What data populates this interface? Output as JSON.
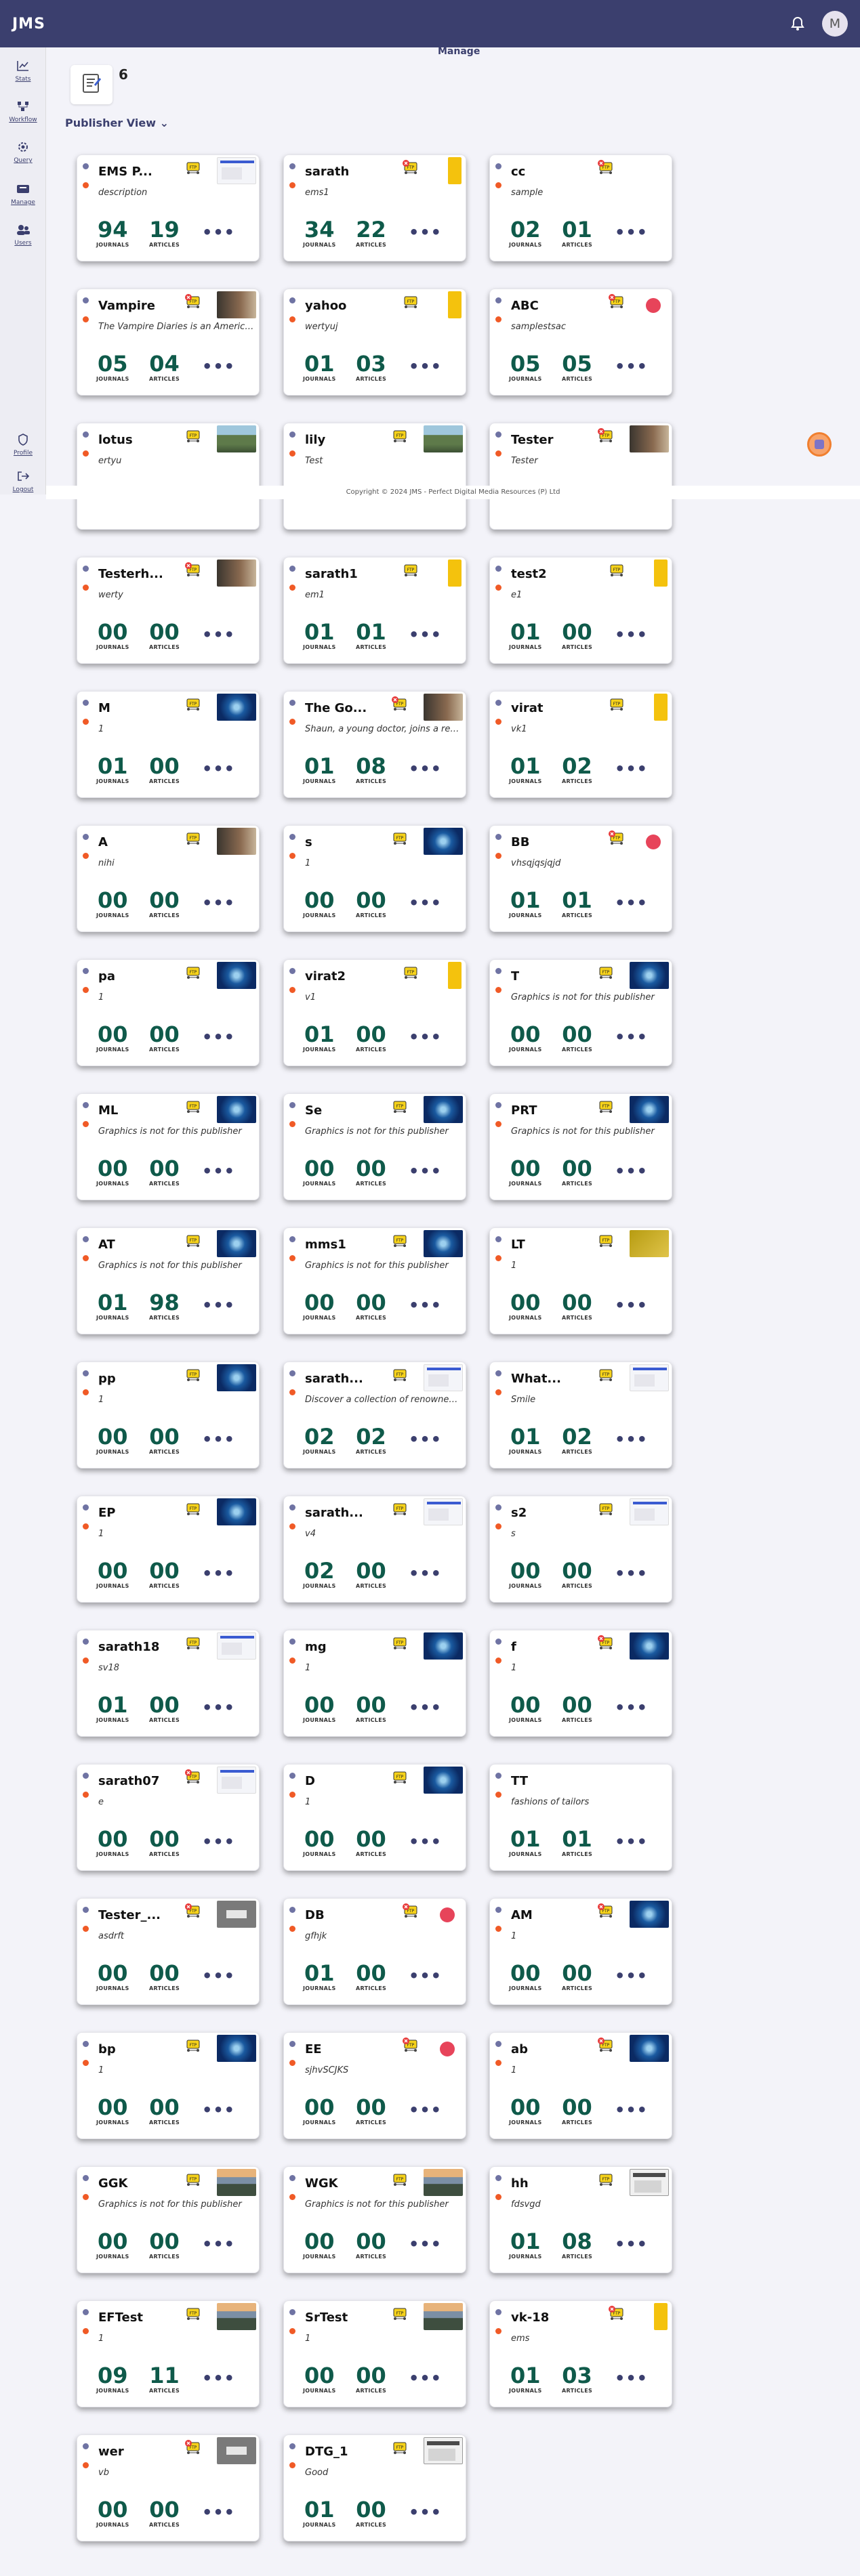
{
  "app": {
    "title": "JMS",
    "avatar_initial": "M"
  },
  "sidebar": {
    "items": [
      {
        "label": "Stats",
        "icon": "chart-line-icon"
      },
      {
        "label": "Workflow",
        "icon": "workflow-icon"
      },
      {
        "label": "Query",
        "icon": "gear-icon"
      },
      {
        "label": "Manage",
        "icon": "manage-icon"
      },
      {
        "label": "Users",
        "icon": "users-icon"
      },
      {
        "label": "Profile",
        "icon": "shield-icon"
      },
      {
        "label": "Logout",
        "icon": "logout-icon"
      }
    ]
  },
  "header": {
    "manage_link": "Manage",
    "publisher_count": "6",
    "publisher_view": "Publisher View"
  },
  "labels": {
    "journals": "JOURNALS",
    "articles": "ARTICLES",
    "more": "•••"
  },
  "footer": {
    "text": "Copyright © 2024 JMS - Perfect Digital Media Resources (P) Ltd"
  },
  "colors": {
    "topbar": "#3b3f6e",
    "accent_number": "#0f5a4a",
    "status_dot_top": "#6f73a3",
    "status_dot_bottom": "#f05a26"
  },
  "publishers": [
    {
      "name": "EMS P...",
      "desc": "description",
      "journals": "94",
      "articles": "19",
      "badge": "ftp",
      "thumb": "screenshot"
    },
    {
      "name": "sarath",
      "desc": "ems1",
      "journals": "34",
      "articles": "22",
      "badge": "ftp-x",
      "thumb": "yellow"
    },
    {
      "name": "cc",
      "desc": "sample",
      "journals": "02",
      "articles": "01",
      "badge": "ftp-x",
      "thumb": "batwing"
    },
    {
      "name": "Vampire",
      "desc": "The Vampire Diaries is an American...",
      "journals": "05",
      "articles": "04",
      "badge": "ftp-x",
      "thumb": "bookcover"
    },
    {
      "name": "yahoo",
      "desc": "wertyuj",
      "journals": "01",
      "articles": "03",
      "badge": "ftp",
      "thumb": "yellow"
    },
    {
      "name": "ABC",
      "desc": "samplestsac",
      "journals": "05",
      "articles": "05",
      "badge": "ftp-x",
      "thumb": "redcircle"
    },
    {
      "name": "lotus",
      "desc": "ertyu",
      "journals": "",
      "articles": "",
      "badge": "ftp",
      "thumb": "landscape"
    },
    {
      "name": "lily",
      "desc": "Test",
      "journals": "",
      "articles": "",
      "badge": "ftp",
      "thumb": "landscape"
    },
    {
      "name": "Tester",
      "desc": "Tester",
      "journals": "",
      "articles": "",
      "badge": "ftp-x",
      "thumb": "bookcover"
    },
    {
      "name": "Testerh...",
      "desc": "werty",
      "journals": "00",
      "articles": "00",
      "badge": "ftp-x",
      "thumb": "bookcover"
    },
    {
      "name": "sarath1",
      "desc": "em1",
      "journals": "01",
      "articles": "01",
      "badge": "ftp",
      "thumb": "yellow"
    },
    {
      "name": "test2",
      "desc": "e1",
      "journals": "01",
      "articles": "00",
      "badge": "ftp",
      "thumb": "yellow"
    },
    {
      "name": "M",
      "desc": "1",
      "journals": "01",
      "articles": "00",
      "badge": "ftp",
      "thumb": "nightsky"
    },
    {
      "name": "The Go...",
      "desc": "Shaun, a young doctor, joins a reno...",
      "journals": "01",
      "articles": "08",
      "badge": "ftp-x",
      "thumb": "bookcover"
    },
    {
      "name": "virat",
      "desc": "vk1",
      "journals": "01",
      "articles": "02",
      "badge": "ftp",
      "thumb": "yellow"
    },
    {
      "name": "A",
      "desc": "nihi",
      "journals": "00",
      "articles": "00",
      "badge": "ftp",
      "thumb": "bookcover"
    },
    {
      "name": "s",
      "desc": "1",
      "journals": "00",
      "articles": "00",
      "badge": "ftp",
      "thumb": "nightsky"
    },
    {
      "name": "BB",
      "desc": "vhsqjqsjqjd",
      "journals": "01",
      "articles": "01",
      "badge": "ftp-x",
      "thumb": "redcircle"
    },
    {
      "name": "pa",
      "desc": "1",
      "journals": "00",
      "articles": "00",
      "badge": "ftp",
      "thumb": "nightsky"
    },
    {
      "name": "virat2",
      "desc": "v1",
      "journals": "01",
      "articles": "00",
      "badge": "ftp",
      "thumb": "yellow"
    },
    {
      "name": "T",
      "desc": "Graphics is not for this publisher",
      "journals": "00",
      "articles": "00",
      "badge": "ftp",
      "thumb": "nightsky"
    },
    {
      "name": "ML",
      "desc": "Graphics is not for this publisher",
      "journals": "00",
      "articles": "00",
      "badge": "ftp",
      "thumb": "nightsky"
    },
    {
      "name": "Se",
      "desc": "Graphics is not for this publisher",
      "journals": "00",
      "articles": "00",
      "badge": "ftp",
      "thumb": "nightsky"
    },
    {
      "name": "PRT",
      "desc": "Graphics is not for this publisher",
      "journals": "00",
      "articles": "00",
      "badge": "ftp",
      "thumb": "nightsky"
    },
    {
      "name": "AT",
      "desc": "Graphics is not for this publisher",
      "journals": "01",
      "articles": "98",
      "badge": "ftp",
      "thumb": "nightsky"
    },
    {
      "name": "mms1",
      "desc": "Graphics is not for this publisher",
      "journals": "00",
      "articles": "00",
      "badge": "ftp",
      "thumb": "nightsky"
    },
    {
      "name": "LT",
      "desc": "1",
      "journals": "00",
      "articles": "00",
      "badge": "ftp",
      "thumb": "gold"
    },
    {
      "name": "pp",
      "desc": "1",
      "journals": "00",
      "articles": "00",
      "badge": "ftp",
      "thumb": "nightsky"
    },
    {
      "name": "sarath...",
      "desc": "Discover a collection of renowned br...",
      "journals": "02",
      "articles": "02",
      "badge": "ftp",
      "thumb": "screenshot"
    },
    {
      "name": "What...",
      "desc": "Smile",
      "journals": "01",
      "articles": "02",
      "badge": "ftp",
      "thumb": "screenshot"
    },
    {
      "name": "EP",
      "desc": "1",
      "journals": "00",
      "articles": "00",
      "badge": "ftp",
      "thumb": "nightsky"
    },
    {
      "name": "sarath...",
      "desc": "v4",
      "journals": "02",
      "articles": "00",
      "badge": "ftp",
      "thumb": "screenshot"
    },
    {
      "name": "s2",
      "desc": "s",
      "journals": "00",
      "articles": "00",
      "badge": "ftp",
      "thumb": "screenshot"
    },
    {
      "name": "sarath18",
      "desc": "sv18",
      "journals": "01",
      "articles": "00",
      "badge": "ftp",
      "thumb": "screenshot"
    },
    {
      "name": "mg",
      "desc": "1",
      "journals": "00",
      "articles": "00",
      "badge": "ftp",
      "thumb": "nightsky"
    },
    {
      "name": "f",
      "desc": "1",
      "journals": "00",
      "articles": "00",
      "badge": "ftp-x",
      "thumb": "nightsky"
    },
    {
      "name": "sarath07",
      "desc": "e",
      "journals": "00",
      "articles": "00",
      "badge": "ftp-x",
      "thumb": "screenshot"
    },
    {
      "name": "D",
      "desc": "1",
      "journals": "00",
      "articles": "00",
      "badge": "ftp",
      "thumb": "nightsky"
    },
    {
      "name": "TT",
      "desc": "fashions of tailors",
      "journals": "01",
      "articles": "01",
      "badge": "none",
      "thumb": "batwing"
    },
    {
      "name": "Tester_...",
      "desc": "asdrft",
      "journals": "00",
      "articles": "00",
      "badge": "ftp-x",
      "thumb": "gray"
    },
    {
      "name": "DB",
      "desc": "gfhjk",
      "journals": "01",
      "articles": "00",
      "badge": "ftp-x",
      "thumb": "redcircle"
    },
    {
      "name": "AM",
      "desc": "1",
      "journals": "00",
      "articles": "00",
      "badge": "ftp-x",
      "thumb": "nightsky"
    },
    {
      "name": "bp",
      "desc": "1",
      "journals": "00",
      "articles": "00",
      "badge": "ftp",
      "thumb": "nightsky"
    },
    {
      "name": "EE",
      "desc": "sjhvSCJKS",
      "journals": "00",
      "articles": "00",
      "badge": "ftp-x",
      "thumb": "redcircle"
    },
    {
      "name": "ab",
      "desc": "1",
      "journals": "00",
      "articles": "00",
      "badge": "ftp-x",
      "thumb": "nightsky"
    },
    {
      "name": "GGK",
      "desc": "Graphics is not for this publisher",
      "journals": "00",
      "articles": "00",
      "badge": "ftp",
      "thumb": "sunset"
    },
    {
      "name": "WGK",
      "desc": "Graphics is not for this publisher",
      "journals": "00",
      "articles": "00",
      "badge": "ftp",
      "thumb": "sunset"
    },
    {
      "name": "hh",
      "desc": "fdsvgd",
      "journals": "01",
      "articles": "08",
      "badge": "ftp",
      "thumb": "dialog"
    },
    {
      "name": "EFTest",
      "desc": "1",
      "journals": "09",
      "articles": "11",
      "badge": "ftp",
      "thumb": "sunset"
    },
    {
      "name": "SrTest",
      "desc": "1",
      "journals": "00",
      "articles": "00",
      "badge": "ftp",
      "thumb": "sunset"
    },
    {
      "name": "vk-18",
      "desc": "ems",
      "journals": "01",
      "articles": "03",
      "badge": "ftp-x",
      "thumb": "yellow"
    },
    {
      "name": "wer",
      "desc": "vb",
      "journals": "00",
      "articles": "00",
      "badge": "ftp-x",
      "thumb": "gray"
    },
    {
      "name": "DTG_1",
      "desc": "Good",
      "journals": "01",
      "articles": "00",
      "badge": "ftp",
      "thumb": "dialog"
    }
  ]
}
